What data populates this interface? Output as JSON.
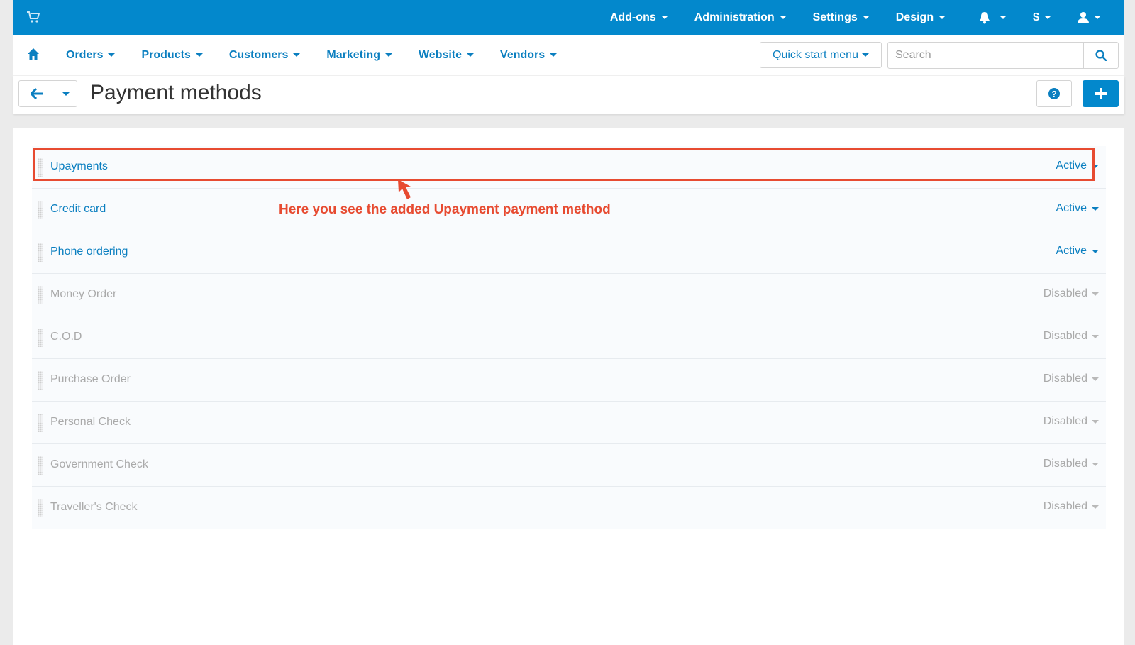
{
  "colors": {
    "brand": "#0388cc",
    "link": "#0b7fc0",
    "disabled": "#aaaaaa",
    "annotation": "#e74b31"
  },
  "topbar": {
    "items": [
      {
        "label": "Add-ons"
      },
      {
        "label": "Administration"
      },
      {
        "label": "Settings"
      },
      {
        "label": "Design"
      },
      {
        "icon": "bell-icon"
      },
      {
        "label": "$"
      },
      {
        "icon": "user-icon"
      }
    ]
  },
  "nav": {
    "items": [
      {
        "label": "Orders"
      },
      {
        "label": "Products"
      },
      {
        "label": "Customers"
      },
      {
        "label": "Marketing"
      },
      {
        "label": "Website"
      },
      {
        "label": "Vendors"
      }
    ],
    "quick_start_label": "Quick start menu",
    "search_placeholder": "Search"
  },
  "title": {
    "text": "Payment methods"
  },
  "payment_methods": [
    {
      "name": "Upayments",
      "status": "Active"
    },
    {
      "name": "Credit card",
      "status": "Active"
    },
    {
      "name": "Phone ordering",
      "status": "Active"
    },
    {
      "name": "Money Order",
      "status": "Disabled"
    },
    {
      "name": "C.O.D",
      "status": "Disabled"
    },
    {
      "name": "Purchase Order",
      "status": "Disabled"
    },
    {
      "name": "Personal Check",
      "status": "Disabled"
    },
    {
      "name": "Government Check",
      "status": "Disabled"
    },
    {
      "name": "Traveller's Check",
      "status": "Disabled"
    }
  ],
  "annotation": {
    "text": "Here you see the added Upayment payment method"
  }
}
